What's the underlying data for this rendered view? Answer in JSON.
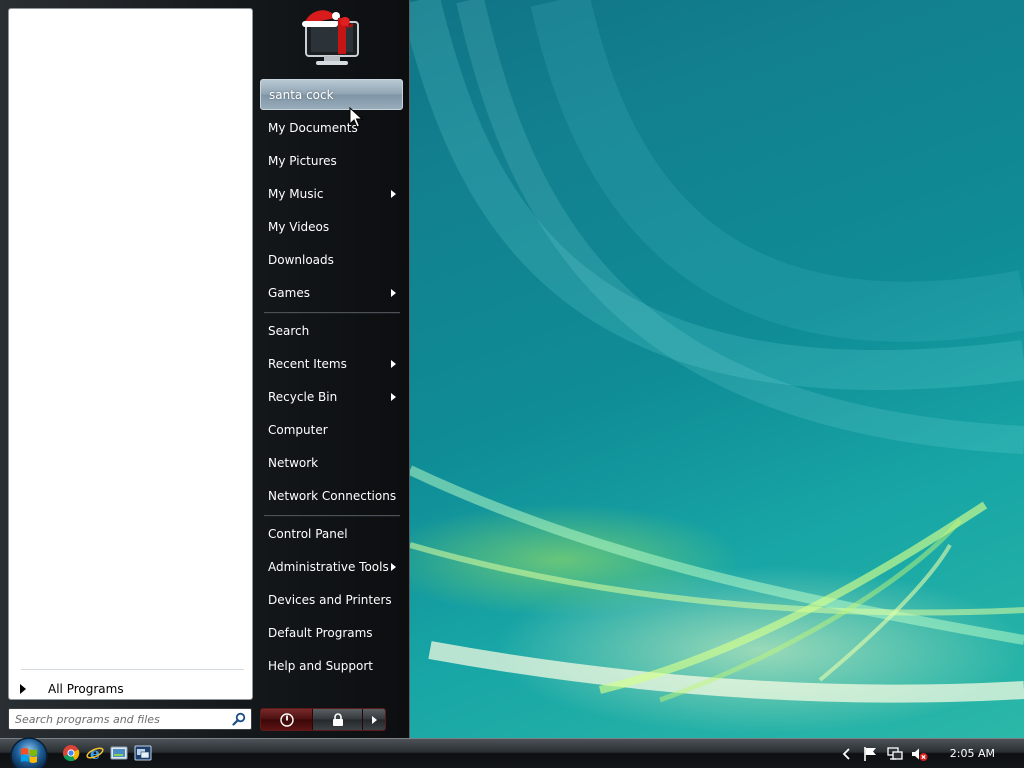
{
  "start_menu": {
    "all_programs_label": "All Programs",
    "search": {
      "placeholder": "Search programs and files",
      "value": ""
    },
    "user_name": "santa cock",
    "right_items": [
      {
        "label": "santa cock",
        "submenu": false,
        "hovered": true
      },
      {
        "label": "My Documents",
        "submenu": false
      },
      {
        "label": "My Pictures",
        "submenu": false
      },
      {
        "label": "My Music",
        "submenu": true
      },
      {
        "label": "My Videos",
        "submenu": false
      },
      {
        "label": "Downloads",
        "submenu": false
      },
      {
        "label": "Games",
        "submenu": true
      },
      {
        "label": "Search",
        "submenu": false
      },
      {
        "label": "Recent Items",
        "submenu": true
      },
      {
        "label": "Recycle Bin",
        "submenu": true
      },
      {
        "label": "Computer",
        "submenu": false
      },
      {
        "label": "Network",
        "submenu": false
      },
      {
        "label": "Network Connections",
        "submenu": false
      },
      {
        "label": "Control Panel",
        "submenu": false
      },
      {
        "label": "Administrative Tools",
        "submenu": true
      },
      {
        "label": "Devices and Printers",
        "submenu": false
      },
      {
        "label": "Default Programs",
        "submenu": false
      },
      {
        "label": "Help and Support",
        "submenu": false
      }
    ],
    "power_buttons": [
      "power-icon",
      "lock-icon",
      "arrow-right-icon"
    ]
  },
  "taskbar": {
    "quicklaunch_icons": [
      "chrome-icon",
      "internet-explorer-icon",
      "show-desktop-icon",
      "switch-windows-icon"
    ],
    "tray_icons": [
      "show-hidden-icons-chevron",
      "action-center-flag-icon",
      "network-icon",
      "volume-muted-icon"
    ],
    "clock": "2:05 AM"
  },
  "colors": {
    "menu_dark": "#14181b",
    "hover_highlight": "#8fa3b2",
    "power_red": "#4a0f0f",
    "desktop_teal": "#0f8c96"
  }
}
